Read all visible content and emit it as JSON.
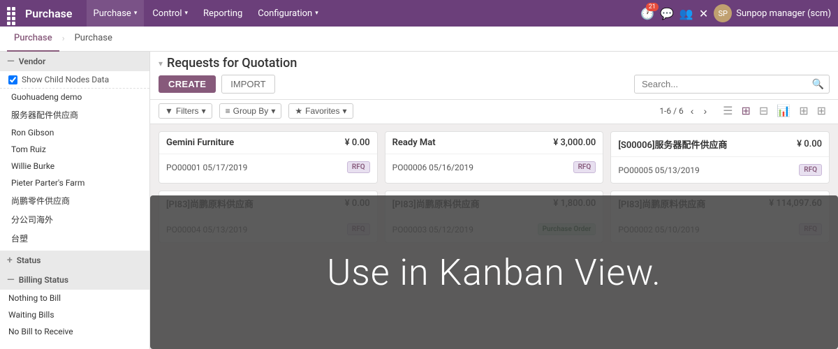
{
  "topnav": {
    "app_title": "Purchase",
    "menu_items": [
      {
        "label": "Purchase",
        "has_dropdown": true
      },
      {
        "label": "Control",
        "has_dropdown": true
      },
      {
        "label": "Reporting",
        "has_dropdown": false
      },
      {
        "label": "Configuration",
        "has_dropdown": true
      }
    ],
    "notification_count": "21",
    "user_label": "Sunpop manager (scm)"
  },
  "secondarynav": {
    "items": [
      {
        "label": "Purchase",
        "active": true
      },
      {
        "label": "Purchase",
        "active": false
      }
    ]
  },
  "breadcrumb": {
    "title": "Requests for Quotation"
  },
  "toolbar": {
    "create_label": "CREATE",
    "import_label": "IMPORT",
    "search_placeholder": "Search...",
    "filters_label": "Filters",
    "groupby_label": "Group By",
    "favorites_label": "Favorites",
    "pagination": "1-6 / 6"
  },
  "sidebar": {
    "vendor_section": "Vendor",
    "show_child_label": "Show Child Nodes Data",
    "vendors": [
      "Guohuadeng demo",
      "服务器配件供应商",
      "Ron Gibson",
      "Tom Ruiz",
      "Willie Burke",
      "Pieter Parter's Farm",
      "尚鹏零件供应商",
      "分公司海外",
      "台塑"
    ],
    "status_section": "Status",
    "billing_section": "Billing Status",
    "billing_items": [
      {
        "label": "Nothing to Bill"
      },
      {
        "label": "Waiting Bills"
      },
      {
        "label": "No Bill to Receive"
      }
    ]
  },
  "kanban": {
    "cards": [
      {
        "title": "Gemini Furniture",
        "amount": "¥ 0.00",
        "ref": "PO00001",
        "date": "05/17/2019",
        "badge": "RFQ",
        "badge_type": "rfq"
      },
      {
        "title": "Ready Mat",
        "amount": "¥ 3,000.00",
        "ref": "PO00006",
        "date": "05/16/2019",
        "badge": "RFQ",
        "badge_type": "rfq"
      },
      {
        "title": "[S00006]服务器配件供应商",
        "amount": "¥ 0.00",
        "ref": "PO00005",
        "date": "05/13/2019",
        "badge": "RFQ",
        "badge_type": "rfq"
      },
      {
        "title": "[PI83]尚鹏原料供应商",
        "amount": "¥ 0.00",
        "ref": "PO00004",
        "date": "05/13/2019",
        "badge": "RFQ",
        "badge_type": "rfq"
      },
      {
        "title": "[PI83]尚鹏原料供应商",
        "amount": "¥ 1,800.00",
        "ref": "PO00003",
        "date": "05/12/2019",
        "badge": "Purchase Order",
        "badge_type": "po"
      },
      {
        "title": "[PI83]尚鹏原料供应商",
        "amount": "¥ 114,097.60",
        "ref": "PO00002",
        "date": "05/10/2019",
        "badge": "RFQ",
        "badge_type": "rfq"
      }
    ],
    "overlay_text": "Use in Kanban View."
  }
}
